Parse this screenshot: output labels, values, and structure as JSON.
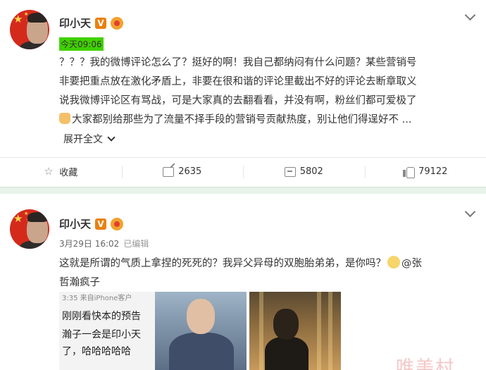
{
  "posts": [
    {
      "author": "印小天",
      "verified_badge": "V",
      "time": "今天09:06",
      "content_lines": [
        "？？？我的微博评论怎么了？挺好的啊！我自己都纳闷有什么问题？某些营销号",
        "非要把重点放在激化矛盾上，非要在很和谐的评论里截出不好的评论去断章取义",
        "说我微博评论区有骂战，可是大家真的去翻看看，并没有啊，粉丝们都可爱极了",
        "大家都别给那些为了流量不择手段的营销号贡献热度，别让他们得逞好不 ..."
      ],
      "expand_label": "展开全文",
      "actions": {
        "favorite_label": "收藏",
        "share_count": "2635",
        "comment_count": "5802",
        "like_count": "79122"
      }
    },
    {
      "author": "印小天",
      "verified_badge": "V",
      "time": "3月29日 16:02",
      "edited": "已编辑",
      "content_line1": "这就是所谓的气质上拿捏的死死的？我异父异母的双胞胎弟弟，是你吗？",
      "mention_part1": "@张",
      "content_line2": "哲瀚疯子",
      "image_text": {
        "line0": "3:35  来自iPhone客户",
        "line1": "刚刚看快本的预告",
        "line2": "瀚子一会是印小天",
        "line3": "了，哈哈哈哈哈"
      }
    }
  ],
  "watermark": "唯美村",
  "colors": {
    "time_highlight": "#3fd100",
    "verified_orange": "#ea8010",
    "separator": "#e8f3ea"
  }
}
